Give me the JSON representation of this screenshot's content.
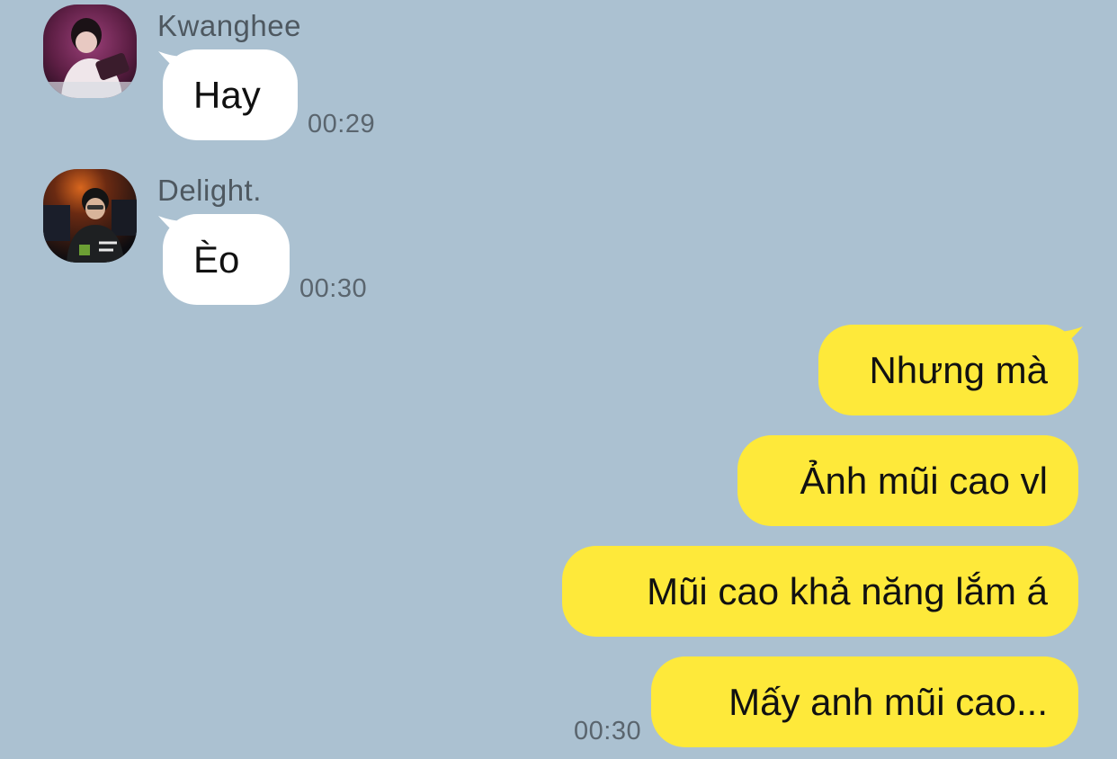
{
  "messages_in": [
    {
      "sender": "Kwanghee",
      "text": "Hay",
      "time": "00:29",
      "avatar_icon": "avatar-kwanghee"
    },
    {
      "sender": "Delight.",
      "text": "Èo",
      "time": "00:30",
      "avatar_icon": "avatar-delight"
    }
  ],
  "messages_out": [
    {
      "text": "Nhưng mà"
    },
    {
      "text": "Ảnh mũi cao vl"
    },
    {
      "text": "Mũi cao khả năng lắm á"
    },
    {
      "text": "Mấy anh mũi cao..."
    }
  ],
  "out_time": "00:30",
  "colors": {
    "background": "#abc1d1",
    "incoming_bubble": "#ffffff",
    "outgoing_bubble": "#fee93a"
  }
}
